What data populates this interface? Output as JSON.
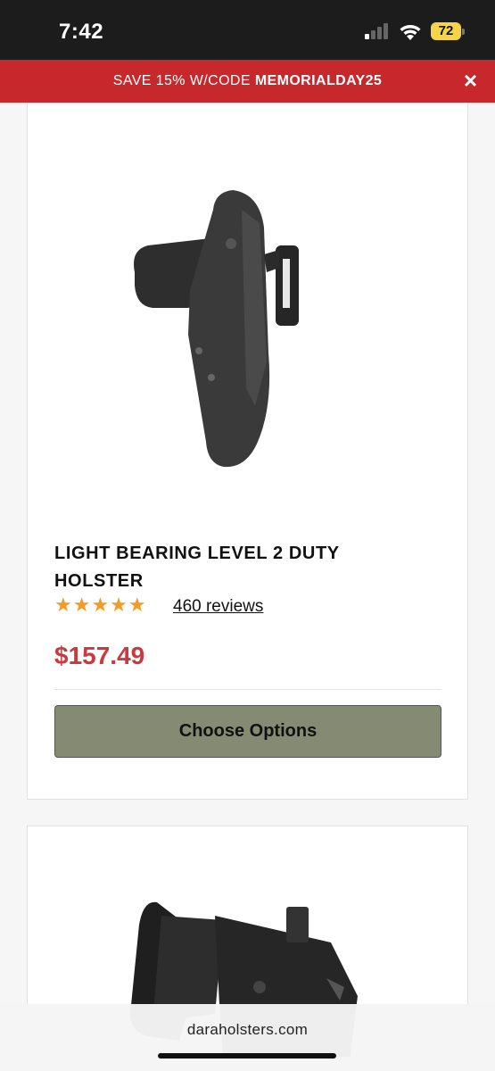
{
  "status_bar": {
    "time": "7:42",
    "battery": "72"
  },
  "promo": {
    "prefix": "SAVE 15% W/CODE ",
    "code": "MEMORIALDAY25",
    "close_icon": "×"
  },
  "product1": {
    "title": "LIGHT BEARING LEVEL 2 DUTY HOLSTER",
    "rating": 5,
    "stars": "★★★★★",
    "reviews": "460 reviews",
    "price": "$157.49",
    "button": "Choose Options"
  },
  "browser": {
    "url": "daraholsters.com"
  },
  "colors": {
    "promo_bg": "#c6282c",
    "price": "#c93a3e",
    "button_bg": "#858b72",
    "star": "#f59a23"
  }
}
